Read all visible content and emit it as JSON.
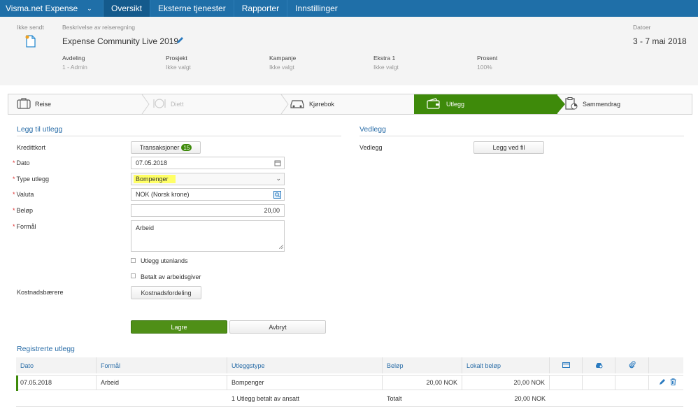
{
  "topbar": {
    "brand": "Visma.net Expense",
    "tabs": [
      "Oversikt",
      "Eksterne tjenester",
      "Rapporter",
      "Innstillinger"
    ]
  },
  "header": {
    "status": "Ikke sendt",
    "desc_label": "Beskrivelse av reiseregning",
    "desc_value": "Expense Community Live 2019",
    "date_label": "Datoer",
    "date_value": "3 - 7 mai 2018",
    "fields": [
      {
        "label": "Avdeling",
        "value": "1 - Admin"
      },
      {
        "label": "Prosjekt",
        "value": "Ikke valgt"
      },
      {
        "label": "Kampanje",
        "value": "Ikke valgt"
      },
      {
        "label": "Ekstra 1",
        "value": "Ikke valgt"
      },
      {
        "label": "Prosent",
        "value": "100%"
      }
    ]
  },
  "steps": [
    "Reise",
    "Diett",
    "Kjørebok",
    "Utlegg",
    "Sammendrag"
  ],
  "form": {
    "title": "Legg til utlegg",
    "kredittkort_label": "Kredittkort",
    "transaksjoner_label": "Transaksjoner",
    "transaksjoner_count": "15",
    "dato_label": "Dato",
    "dato_value": "07.05.2018",
    "type_label": "Type utlegg",
    "type_value_a": "Bo",
    "type_value_b": "mpenger",
    "valuta_label": "Valuta",
    "valuta_value": "NOK (Norsk krone)",
    "belop_label": "Beløp",
    "belop_value": "20,00",
    "formal_label": "Formål",
    "formal_value": "Arbeid",
    "utenlands_label": "Utlegg utenlands",
    "arbeidsgiver_label": "Betalt av arbeidsgiver",
    "kostnad_label": "Kostnadsbærere",
    "kostnad_button": "Kostnadsfordeling",
    "save": "Lagre",
    "cancel": "Avbryt"
  },
  "vedlegg": {
    "title": "Vedlegg",
    "label": "Vedlegg",
    "button": "Legg ved fil"
  },
  "registered": {
    "title": "Registrerte utlegg",
    "headers": [
      "Dato",
      "Formål",
      "Utleggstype",
      "Beløp",
      "Lokalt beløp"
    ],
    "row": {
      "dato": "07.05.2018",
      "formal": "Arbeid",
      "type": "Bompenger",
      "belop": "20,00 NOK",
      "lokalt": "20,00 NOK"
    },
    "summary": {
      "count": "1 Utlegg betalt av ansatt",
      "total_label": "Totalt",
      "total": "20,00 NOK"
    }
  },
  "colors": {
    "topbar": "#1f6fa8",
    "active_step": "#3e8a0a",
    "link": "#2b6ea8"
  }
}
